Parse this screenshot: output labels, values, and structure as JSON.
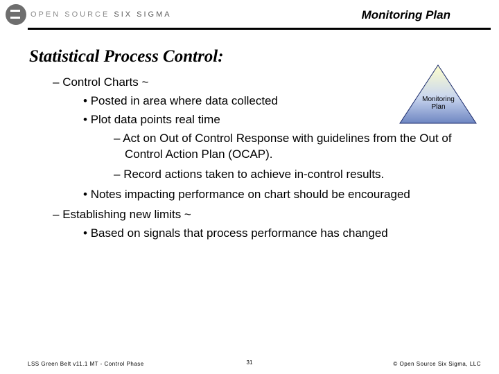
{
  "brand": {
    "name_a": "OPEN SOURCE",
    "name_b": "SIX SIGMA"
  },
  "header": {
    "title": "Monitoring Plan"
  },
  "triangle": {
    "line1": "Monitoring",
    "line2": "Plan"
  },
  "section_title": "Statistical Process Control:",
  "body": {
    "l1a": "Control Charts ~",
    "l2a": "Posted in area where data collected",
    "l2b": "Plot data points real time",
    "l3a": "Act on Out of Control Response with guidelines from the Out of Control Action Plan (OCAP).",
    "l3b": "Record actions taken to achieve in-control results.",
    "l2c": "Notes impacting performance on chart should be encouraged",
    "l1b": "Establishing new limits ~",
    "l2d": "Based on signals that process performance has changed"
  },
  "footer": {
    "left": "LSS Green Belt v11.1 MT - Control Phase",
    "page": "31",
    "right": "©  Open Source Six Sigma, LLC"
  }
}
